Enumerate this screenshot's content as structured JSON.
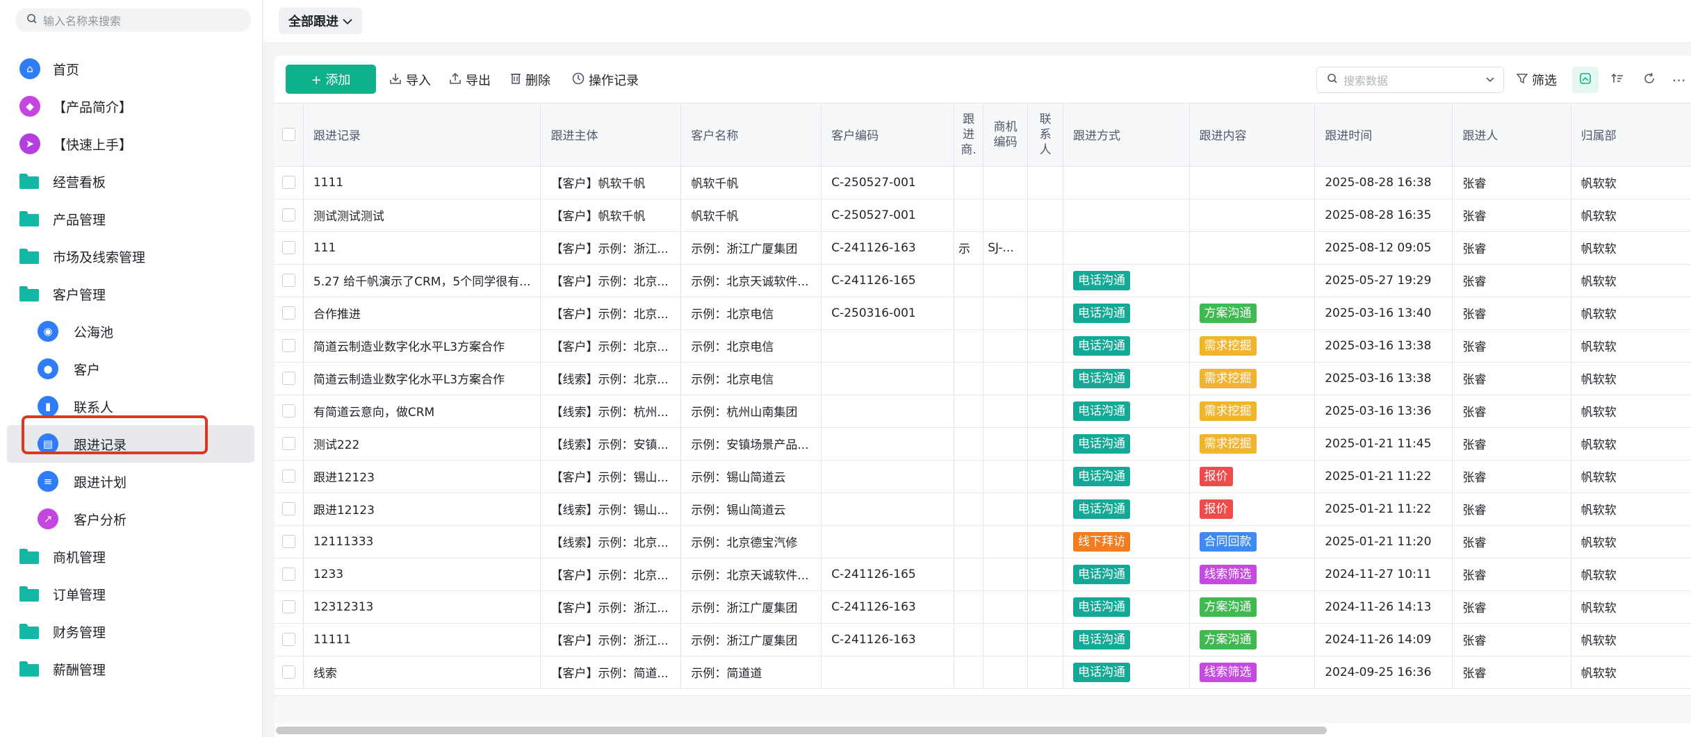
{
  "sidebar": {
    "search_placeholder": "输入名称来搜索",
    "items": [
      {
        "label": "首页",
        "icon": "home-icon",
        "color": "#2f7cf6"
      },
      {
        "label": "【产品简介】",
        "icon": "tag-icon",
        "color": "#c445e0"
      },
      {
        "label": "【快速上手】",
        "icon": "send-icon",
        "color": "#b53ee0"
      },
      {
        "label": "经营看板",
        "icon": "folder-icon"
      },
      {
        "label": "产品管理",
        "icon": "folder-icon"
      },
      {
        "label": "市场及线索管理",
        "icon": "folder-icon"
      },
      {
        "label": "客户管理",
        "icon": "folder-open-icon"
      },
      {
        "label": "公海池",
        "icon": "pool-icon",
        "color": "#2f7cf6"
      },
      {
        "label": "客户",
        "icon": "customer-icon",
        "color": "#2f7cf6"
      },
      {
        "label": "联系人",
        "icon": "contact-icon",
        "color": "#2f7cf6"
      },
      {
        "label": "跟进记录",
        "icon": "record-icon",
        "color": "#2f7cf6"
      },
      {
        "label": "跟进计划",
        "icon": "plan-icon",
        "color": "#2f7cf6"
      },
      {
        "label": "客户分析",
        "icon": "analysis-icon",
        "color": "#c445e0"
      },
      {
        "label": "商机管理",
        "icon": "folder-icon"
      },
      {
        "label": "订单管理",
        "icon": "folder-icon"
      },
      {
        "label": "财务管理",
        "icon": "folder-icon"
      },
      {
        "label": "薪酬管理",
        "icon": "folder-icon"
      }
    ]
  },
  "header": {
    "filter_label": "全部跟进"
  },
  "toolbar": {
    "add": "+ 添加",
    "import": "导入",
    "export": "导出",
    "delete": "删除",
    "log": "操作记录",
    "search_placeholder": "搜索数据",
    "filter": "筛选"
  },
  "table": {
    "columns": [
      "跟进记录",
      "跟进主体",
      "客户名称",
      "客户编码",
      "跟进商.",
      "商机编码",
      "联系人",
      "跟进方式",
      "跟进内容",
      "跟进时间",
      "跟进人",
      "归属部"
    ],
    "column_headers_wrapped": {
      "c5": [
        "跟",
        "进",
        "商."
      ],
      "c6": [
        "商机",
        "编码"
      ],
      "c7": [
        "联",
        "系",
        "人"
      ]
    },
    "rows": [
      {
        "record": "1111",
        "subject": "【客户】帆软千帆",
        "customer": "帆软千帆",
        "code": "C-250527-001",
        "opp": "",
        "oppcode": "",
        "contact": "",
        "method": "",
        "content": "",
        "time": "2025-08-28 16:38",
        "person": "张睿",
        "dept": "帆软软"
      },
      {
        "record": "测试测试测试",
        "subject": "【客户】帆软千帆",
        "customer": "帆软千帆",
        "code": "C-250527-001",
        "opp": "",
        "oppcode": "",
        "contact": "",
        "method": "",
        "content": "",
        "time": "2025-08-28 16:35",
        "person": "张睿",
        "dept": "帆软软"
      },
      {
        "record": "111",
        "subject": "【客户】示例：浙江...",
        "customer": "示例：浙江广厦集团",
        "code": "C-241126-163",
        "opp": "示",
        "oppcode": "SJ-...",
        "contact": "",
        "method": "",
        "content": "",
        "time": "2025-08-12 09:05",
        "person": "张睿",
        "dept": "帆软软"
      },
      {
        "record": "5.27 给千帆演示了CRM，5个同学很有...",
        "subject": "【客户】示例：北京...",
        "customer": "示例：北京天诚软件...",
        "code": "C-241126-165",
        "opp": "",
        "oppcode": "",
        "contact": "",
        "method": "电话沟通",
        "content": "",
        "time": "2025-05-27 19:29",
        "person": "张睿",
        "dept": "帆软软"
      },
      {
        "record": "合作推进",
        "subject": "【客户】示例：北京...",
        "customer": "示例：北京电信",
        "code": "C-250316-001",
        "opp": "",
        "oppcode": "",
        "contact": "",
        "method": "电话沟通",
        "content": "方案沟通",
        "time": "2025-03-16 13:40",
        "person": "张睿",
        "dept": "帆软软"
      },
      {
        "record": "简道云制造业数字化水平L3方案合作",
        "subject": "【客户】示例：北京...",
        "customer": "示例：北京电信",
        "code": "",
        "opp": "",
        "oppcode": "",
        "contact": "",
        "method": "电话沟通",
        "content": "需求挖掘",
        "time": "2025-03-16 13:38",
        "person": "张睿",
        "dept": "帆软软"
      },
      {
        "record": "简道云制造业数字化水平L3方案合作",
        "subject": "【线索】示例：北京...",
        "customer": "示例：北京电信",
        "code": "",
        "opp": "",
        "oppcode": "",
        "contact": "",
        "method": "电话沟通",
        "content": "需求挖掘",
        "time": "2025-03-16 13:38",
        "person": "张睿",
        "dept": "帆软软"
      },
      {
        "record": "有简道云意向，做CRM",
        "subject": "【线索】示例：杭州...",
        "customer": "示例：杭州山南集团",
        "code": "",
        "opp": "",
        "oppcode": "",
        "contact": "",
        "method": "电话沟通",
        "content": "需求挖掘",
        "time": "2025-03-16 13:36",
        "person": "张睿",
        "dept": "帆软软"
      },
      {
        "record": "测试222",
        "subject": "【线索】示例：安镇...",
        "customer": "示例：安镇场景产品...",
        "code": "",
        "opp": "",
        "oppcode": "",
        "contact": "",
        "method": "电话沟通",
        "content": "需求挖掘",
        "time": "2025-01-21 11:45",
        "person": "张睿",
        "dept": "帆软软"
      },
      {
        "record": "跟进12123",
        "subject": "【客户】示例：锡山...",
        "customer": "示例：锡山简道云",
        "code": "",
        "opp": "",
        "oppcode": "",
        "contact": "",
        "method": "电话沟通",
        "content": "报价",
        "time": "2025-01-21 11:22",
        "person": "张睿",
        "dept": "帆软软"
      },
      {
        "record": "跟进12123",
        "subject": "【线索】示例：锡山...",
        "customer": "示例：锡山简道云",
        "code": "",
        "opp": "",
        "oppcode": "",
        "contact": "",
        "method": "电话沟通",
        "content": "报价",
        "time": "2025-01-21 11:22",
        "person": "张睿",
        "dept": "帆软软"
      },
      {
        "record": "12111333",
        "subject": "【线索】示例：北京...",
        "customer": "示例：北京德宝汽修",
        "code": "",
        "opp": "",
        "oppcode": "",
        "contact": "",
        "method": "线下拜访",
        "content": "合同回款",
        "time": "2025-01-21 11:20",
        "person": "张睿",
        "dept": "帆软软"
      },
      {
        "record": "1233",
        "subject": "【客户】示例：北京...",
        "customer": "示例：北京天诚软件...",
        "code": "C-241126-165",
        "opp": "",
        "oppcode": "",
        "contact": "",
        "method": "电话沟通",
        "content": "线索筛选",
        "time": "2024-11-27 10:11",
        "person": "张睿",
        "dept": "帆软软"
      },
      {
        "record": "12312313",
        "subject": "【客户】示例：浙江...",
        "customer": "示例：浙江广厦集团",
        "code": "C-241126-163",
        "opp": "",
        "oppcode": "",
        "contact": "",
        "method": "电话沟通",
        "content": "方案沟通",
        "time": "2024-11-26 14:13",
        "person": "张睿",
        "dept": "帆软软"
      },
      {
        "record": "11111",
        "subject": "【客户】示例：浙江...",
        "customer": "示例：浙江广厦集团",
        "code": "C-241126-163",
        "opp": "",
        "oppcode": "",
        "contact": "",
        "method": "电话沟通",
        "content": "方案沟通",
        "time": "2024-11-26 14:09",
        "person": "张睿",
        "dept": "帆软软"
      },
      {
        "record": "线索",
        "subject": "【客户】示例：简道...",
        "customer": "示例：简道道",
        "code": "",
        "opp": "",
        "oppcode": "",
        "contact": "",
        "method": "电话沟通",
        "content": "线索筛选",
        "time": "2024-09-25 16:36",
        "person": "张睿",
        "dept": "帆软软"
      }
    ]
  },
  "tag_colors": {
    "电话沟通": "#14a896",
    "线下拜访": "#f27c1e",
    "方案沟通": "#3fb950",
    "需求挖掘": "#f2b32e",
    "报价": "#ee4b4b",
    "合同回款": "#3d8bf2",
    "线索筛选": "#c54be0"
  }
}
